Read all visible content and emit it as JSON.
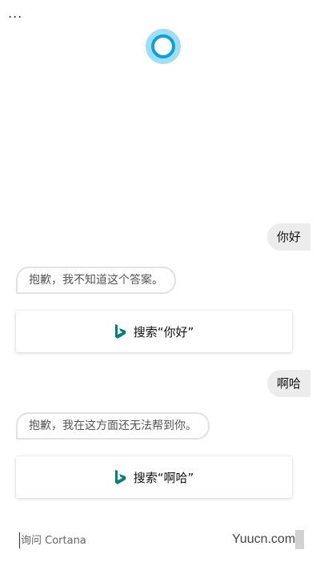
{
  "header": {
    "more_label": "..."
  },
  "conversation": [
    {
      "role": "user",
      "text": "你好"
    },
    {
      "role": "assistant",
      "text": "抱歉，我不知道这个答案。"
    },
    {
      "role": "card",
      "text": "搜索“你好”",
      "icon": "bing-icon"
    },
    {
      "role": "user",
      "text": "啊哈"
    },
    {
      "role": "assistant",
      "text": "抱歉，我在这方面还无法帮到你。"
    },
    {
      "role": "card",
      "text": "搜索“啊哈”",
      "icon": "bing-icon"
    }
  ],
  "ask_bar": {
    "placeholder": "询问 Cortana",
    "value": ""
  },
  "watermark": "Yuucn.com",
  "colors": {
    "cortana_ring": "#0f9fe0",
    "cortana_glow": "#9ddff5",
    "bing": "#008373"
  }
}
